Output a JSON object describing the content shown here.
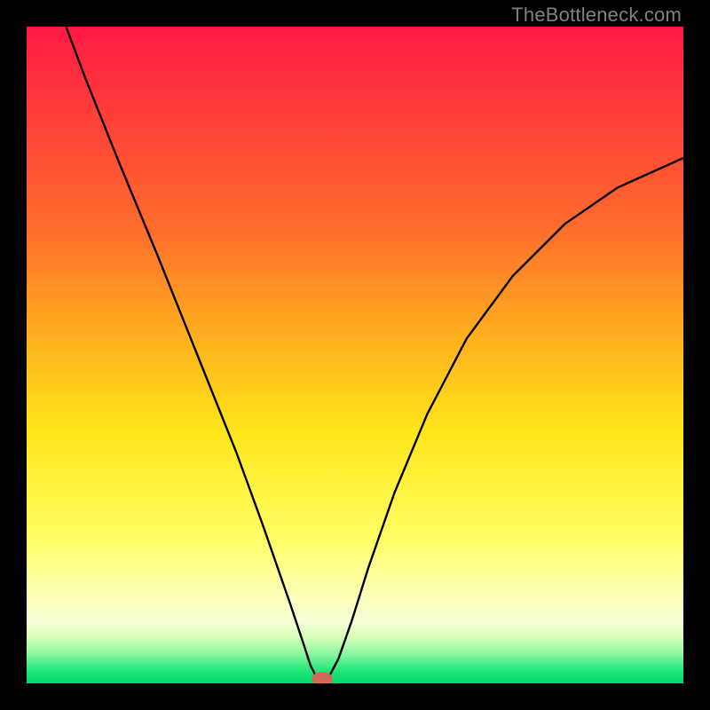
{
  "watermark": "TheBottleneck.com",
  "chart_data": {
    "type": "line",
    "title": "",
    "xlabel": "",
    "ylabel": "",
    "xlim": [
      0,
      100
    ],
    "ylim": [
      0,
      100
    ],
    "background": {
      "gradient_stops": [
        {
          "offset": 0.0,
          "color": "#ff1a44"
        },
        {
          "offset": 0.12,
          "color": "#ff3a3a"
        },
        {
          "offset": 0.3,
          "color": "#ff6a2d"
        },
        {
          "offset": 0.48,
          "color": "#ffb21e"
        },
        {
          "offset": 0.62,
          "color": "#ffe61a"
        },
        {
          "offset": 0.78,
          "color": "#ffff66"
        },
        {
          "offset": 0.86,
          "color": "#fcffb0"
        },
        {
          "offset": 0.905,
          "color": "#f8ffd8"
        },
        {
          "offset": 0.93,
          "color": "#d8ffb8"
        },
        {
          "offset": 0.955,
          "color": "#8cf7a0"
        },
        {
          "offset": 0.98,
          "color": "#22e879"
        },
        {
          "offset": 1.0,
          "color": "#00d868"
        }
      ]
    },
    "series": [
      {
        "name": "curve",
        "stroke": "#000000",
        "stroke_width": 2.4,
        "points": [
          {
            "x": 6.0,
            "y": 100.0
          },
          {
            "x": 9.0,
            "y": 92.0
          },
          {
            "x": 14.0,
            "y": 79.5
          },
          {
            "x": 20.0,
            "y": 65.0
          },
          {
            "x": 26.0,
            "y": 50.0
          },
          {
            "x": 32.0,
            "y": 35.0
          },
          {
            "x": 36.0,
            "y": 24.0
          },
          {
            "x": 40.0,
            "y": 12.5
          },
          {
            "x": 42.0,
            "y": 6.5
          },
          {
            "x": 43.2,
            "y": 2.8
          },
          {
            "x": 44.0,
            "y": 1.2
          },
          {
            "x": 44.8,
            "y": 0.6
          },
          {
            "x": 45.5,
            "y": 0.6
          },
          {
            "x": 46.3,
            "y": 1.5
          },
          {
            "x": 47.5,
            "y": 3.8
          },
          {
            "x": 49.5,
            "y": 9.5
          },
          {
            "x": 52.0,
            "y": 17.5
          },
          {
            "x": 56.0,
            "y": 29.0
          },
          {
            "x": 61.0,
            "y": 41.0
          },
          {
            "x": 67.0,
            "y": 52.5
          },
          {
            "x": 74.0,
            "y": 62.0
          },
          {
            "x": 82.0,
            "y": 70.0
          },
          {
            "x": 90.0,
            "y": 75.5
          },
          {
            "x": 100.0,
            "y": 80.0
          }
        ]
      }
    ],
    "marker": {
      "x": 45.0,
      "y": 0.0,
      "rx": 1.6,
      "ry": 1.1,
      "fill": "#d06a56"
    }
  }
}
